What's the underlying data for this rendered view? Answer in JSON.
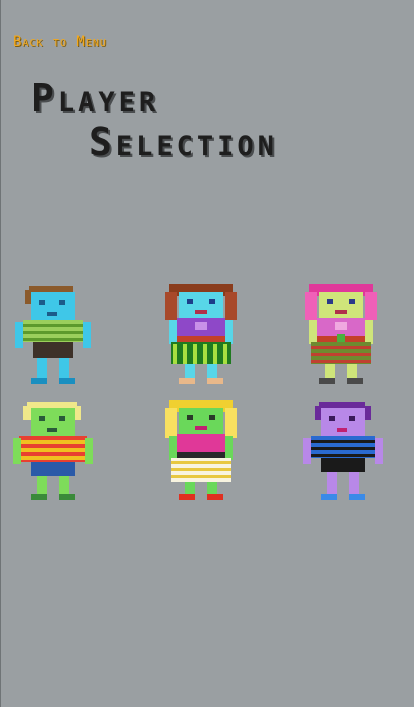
{
  "menu": {
    "back_label": "Back to Menu"
  },
  "title": {
    "line1": "Player",
    "line2": "Selection"
  },
  "colors": {
    "background": "#9a9fa2",
    "back_link": "#f2a81d",
    "title": "#1e1e1e"
  },
  "characters": [
    {
      "icon": "boy-blue-skin-icon"
    },
    {
      "icon": "girl-brown-hair-icon"
    },
    {
      "icon": "girl-pink-hair-icon"
    },
    {
      "icon": "boy-blonde-hair-icon"
    },
    {
      "icon": "girl-blonde-hair-icon"
    },
    {
      "icon": "boy-purple-skin-icon"
    }
  ]
}
